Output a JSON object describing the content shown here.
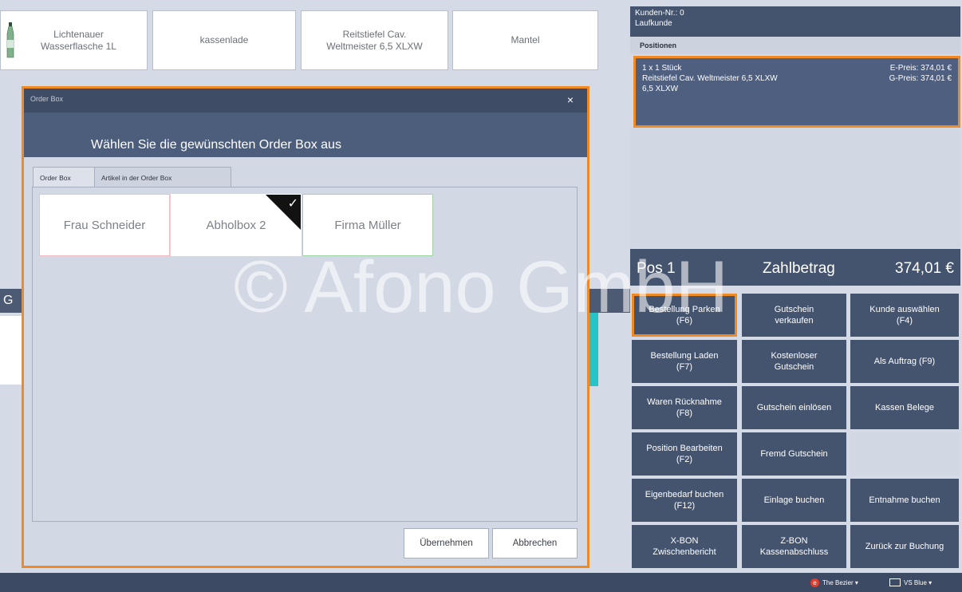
{
  "products": [
    {
      "label": "Lichtenauer\nWasserflasche 1L"
    },
    {
      "label": "kassenlade"
    },
    {
      "label": "Reitstiefel Cav.\nWeltmeister 6,5 XLXW"
    },
    {
      "label": "Mantel"
    }
  ],
  "side_fragment": "G",
  "dialog": {
    "title": "Order Box",
    "close": "×",
    "header": "Wählen Sie die gewünschten Order Box aus",
    "tabs": [
      "Order Box",
      "Artikel in der Order Box"
    ],
    "boxes": [
      {
        "label": "Frau Schneider",
        "border": "#f2bcc4"
      },
      {
        "label": "Abholbox 2",
        "border": "#ffffff",
        "selected": true
      },
      {
        "label": "Firma Müller",
        "border": "#9fd4a3"
      }
    ],
    "check": "✓",
    "btn_ok": "Übernehmen",
    "btn_cancel": "Abbrechen"
  },
  "customer": {
    "line1": "Kunden-Nr.: 0",
    "line2": "Laufkunde"
  },
  "positions": {
    "title": "Positionen",
    "qty": "1 x 1 Stück",
    "name": "Reitstiefel Cav. Weltmeister 6,5 XLXW",
    "variant": "6,5 XLXW",
    "e_price": "E-Preis: 374,01 €",
    "g_price": "G-Preis: 374,01 €"
  },
  "summary": {
    "pos": "Pos 1",
    "label": "Zahlbetrag",
    "amount": "374,01 €"
  },
  "function_buttons": [
    "Bestellung Parken\n(F6)",
    "Gutschein\nverkaufen",
    "Kunde auswählen\n(F4)",
    "Bestellung Laden\n(F7)",
    "Kostenloser\nGutschein",
    "Als Auftrag (F9)",
    "Waren Rücknahme\n(F8)",
    "Gutschein einlösen",
    "Kassen Belege",
    "Position Bearbeiten\n(F2)",
    "Fremd Gutschein",
    "",
    "Eigenbedarf buchen\n(F12)",
    "Einlage buchen",
    "Entnahme buchen",
    "X-BON\nZwischenbericht",
    "Z-BON\nKassenabschluss",
    "Zurück zur Buchung"
  ],
  "watermark": "© Afono GmbH",
  "taskbar": {
    "item1": "The Bezier ▾",
    "item2": "VS Blue ▾"
  },
  "colors": {
    "highlight": "#f08a24",
    "panel_dark": "#44536e",
    "teal": "#28c3c6"
  }
}
